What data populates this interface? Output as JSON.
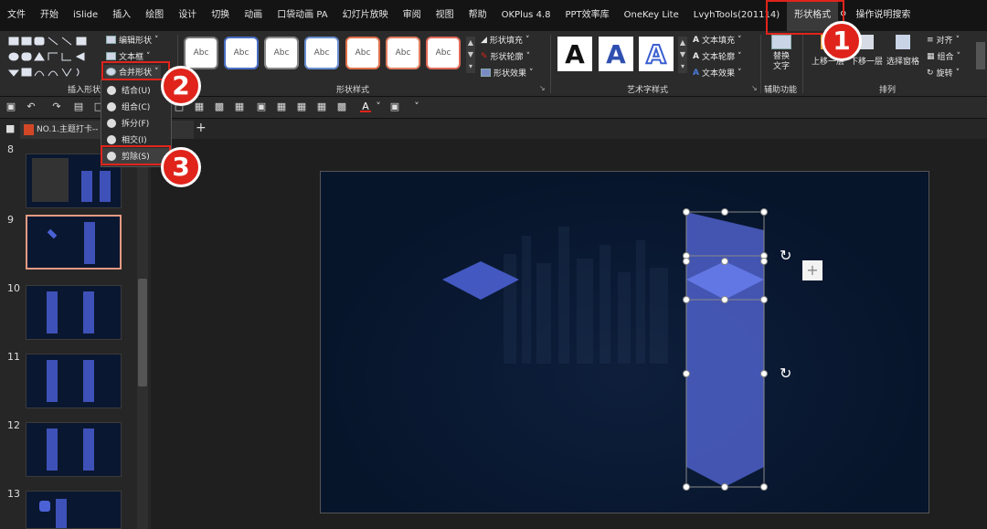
{
  "menubar": {
    "items": [
      {
        "label": "文件"
      },
      {
        "label": "开始"
      },
      {
        "label": "iSlide"
      },
      {
        "label": "插入"
      },
      {
        "label": "绘图"
      },
      {
        "label": "设计"
      },
      {
        "label": "切换"
      },
      {
        "label": "动画"
      },
      {
        "label": "口袋动画 PA"
      },
      {
        "label": "幻灯片放映"
      },
      {
        "label": "审阅"
      },
      {
        "label": "视图"
      },
      {
        "label": "帮助"
      },
      {
        "label": "OKPlus 4.8"
      },
      {
        "label": "PPT效率库"
      },
      {
        "label": "OneKey Lite"
      },
      {
        "label": "LvyhTools(201114)"
      },
      {
        "label": "形状格式"
      }
    ],
    "search_label": "操作说明搜索"
  },
  "ribbon": {
    "insert_shapes": {
      "edit_shape": "编辑形状",
      "text_box": "文本框",
      "merge_shapes": "合并形状",
      "group_label": "插入形状"
    },
    "shape_styles": {
      "swatch_label": "Abc",
      "fill": "形状填充",
      "outline": "形状轮廓",
      "effects": "形状效果",
      "group_label": "形状样式"
    },
    "wordart": {
      "letter": "A",
      "text_fill": "文本填充",
      "text_outline": "文本轮廓",
      "text_effects": "文本效果",
      "group_label": "艺术字样式"
    },
    "accessibility": {
      "alt_text": "替换文字",
      "group_label": "辅助功能"
    },
    "arrange": {
      "bring_forward": "上移一层",
      "send_backward": "下移一层",
      "selection_pane": "选择窗格",
      "align": "对齐",
      "group": "组合",
      "rotate": "旋转",
      "group_label": "排列"
    }
  },
  "dropdown": {
    "items": [
      {
        "label": "结合(U)"
      },
      {
        "label": "组合(C)"
      },
      {
        "label": "拆分(F)"
      },
      {
        "label": "相交(I)"
      },
      {
        "label": "剪除(S)"
      }
    ]
  },
  "document_tab": {
    "title": "NO.1.主题打卡--"
  },
  "thumbnails": [
    {
      "num": "8"
    },
    {
      "num": "9"
    },
    {
      "num": "10"
    },
    {
      "num": "11"
    },
    {
      "num": "12"
    },
    {
      "num": "13"
    }
  ],
  "steps": [
    "1",
    "2",
    "3"
  ],
  "colors": {
    "accent_red": "#e0241b",
    "shape_blue": "#3e51b8",
    "slide_bg": "#07152b"
  }
}
